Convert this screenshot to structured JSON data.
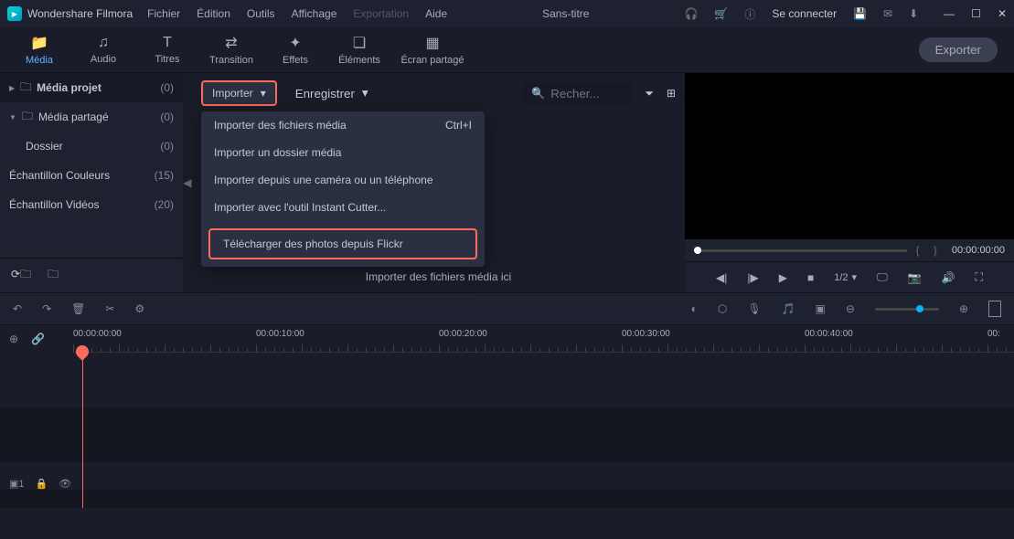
{
  "app": {
    "name": "Wondershare Filmora",
    "title": "Sans-titre"
  },
  "menu": {
    "file": "Fichier",
    "edit": "Édition",
    "tools": "Outils",
    "view": "Affichage",
    "export": "Exportation",
    "help": "Aide"
  },
  "titlebar": {
    "login": "Se connecter"
  },
  "tabs": {
    "media": "Média",
    "audio": "Audio",
    "titles": "Titres",
    "transition": "Transition",
    "effects": "Effets",
    "elements": "Éléments",
    "split": "Écran partagé"
  },
  "toolbar": {
    "export": "Exporter"
  },
  "sidebar": {
    "items": [
      {
        "label": "Média projet",
        "count": "(0)"
      },
      {
        "label": "Média partagé",
        "count": "(0)"
      },
      {
        "label": "Dossier",
        "count": "(0)"
      },
      {
        "label": "Échantillon Couleurs",
        "count": "(15)"
      },
      {
        "label": "Échantillon Vidéos",
        "count": "(20)"
      }
    ]
  },
  "content": {
    "import": "Importer",
    "record": "Enregistrer",
    "search": "Recher...",
    "dropzone": "Importer des fichiers média ici"
  },
  "dropdown": {
    "items": [
      {
        "label": "Importer des fichiers média",
        "shortcut": "Ctrl+I"
      },
      {
        "label": "Importer un dossier média",
        "shortcut": ""
      },
      {
        "label": "Importer depuis une caméra ou un téléphone",
        "shortcut": ""
      },
      {
        "label": "Importer avec l'outil Instant Cutter...",
        "shortcut": ""
      }
    ],
    "highlight": "Télécharger des photos depuis Flickr"
  },
  "preview": {
    "timecode": "00:00:00:00",
    "scale": "1/2"
  },
  "ruler": [
    "00:00:00:00",
    "00:00:10:00",
    "00:00:20:00",
    "00:00:30:00",
    "00:00:40:00",
    "00:"
  ],
  "track": {
    "label": "▣1"
  }
}
